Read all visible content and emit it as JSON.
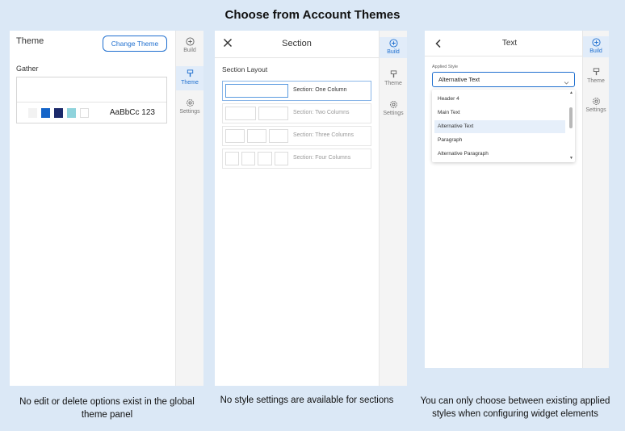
{
  "page_title": "Choose from Account Themes",
  "rail": {
    "build": "Build",
    "theme": "Theme",
    "settings": "Settings"
  },
  "panel1": {
    "header": "Theme",
    "change_theme_button": "Change Theme",
    "theme_name": "Gather",
    "swatches": [
      "#f2f2f2",
      "#1464c8",
      "#1c2a6b",
      "#8fd3dc",
      "#ffffff"
    ],
    "font_sample": "AaBbCc 123"
  },
  "panel2": {
    "header": "Section",
    "section_layout_label": "Section Layout",
    "layouts": [
      "Section: One Column",
      "Section: Two Columns",
      "Section: Three Columns",
      "Section: Four Columns"
    ]
  },
  "panel3": {
    "header": "Text",
    "applied_style_label": "Applied Style",
    "selected_value": "Alternative Text",
    "options": [
      "Header 4",
      "Main Text",
      "Alternative Text",
      "Paragraph",
      "Alternative Paragraph"
    ]
  },
  "captions": {
    "c1": "No edit or delete options exist in the global theme panel",
    "c2": "No style settings are available for sections",
    "c3": "You can only choose between existing applied styles when configuring widget elements"
  },
  "colors": {
    "accent": "#1f6fcf",
    "background": "#dbe8f6"
  }
}
